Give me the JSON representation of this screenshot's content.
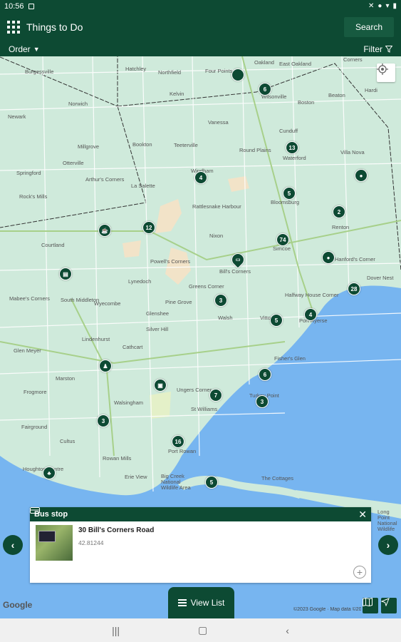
{
  "status": {
    "time": "10:56"
  },
  "header": {
    "title": "Things to Do",
    "search_label": "Search",
    "order_label": "Order",
    "filter_label": "Filter"
  },
  "map": {
    "places": [
      "Burgessville",
      "Hatchley",
      "Northfield",
      "Four Points",
      "Oakland",
      "East Oakland",
      "Corners",
      "Norwich",
      "Kelvin",
      "Wilsonville",
      "Boston",
      "Beaton",
      "Hardi",
      "Newark",
      "Vanessa",
      "Cunduff",
      "Millgrove",
      "Otterville",
      "Bookton",
      "Teeterville",
      "Round Plains",
      "Waterford",
      "Villa Nova",
      "Windham",
      "Springford",
      "Arthur's Corners",
      "La Salette",
      "Bloomsburg",
      "Rock's Mills",
      "Rattlesnake Harbour",
      "Renton",
      "Courtland",
      "Nixon",
      "Simcoe",
      "Bill's Corners",
      "Powell's Corners",
      "Lynedoch",
      "Greens Corner",
      "Mabee's Corners",
      "South Middleton",
      "Wyecombe",
      "Pine Grove",
      "Walsh",
      "Vittoria",
      "Port Ryerse",
      "Hanford's Corner",
      "Dover Nest",
      "Halfway House Corner",
      "Glenshee",
      "Silver Hill",
      "Lindenhurst",
      "Cathcart",
      "Fisher's Glen",
      "Glen Meyer",
      "Marston",
      "Frogmore",
      "Ungers Corner",
      "Turkey Point",
      "Walsingham",
      "St Williams",
      "Fairground",
      "Cultus",
      "Port Rowan",
      "Rowan Mills",
      "Erie View",
      "Big Creek National Wildlife Area",
      "Houghton Centre",
      "The Cottages",
      "Long Point National Wildlife"
    ],
    "markers": [
      "",
      "6",
      "13",
      "4",
      "5",
      "2",
      "12",
      "74",
      "",
      "",
      "",
      "3",
      "28",
      "5",
      "4",
      "",
      "6",
      "7",
      "3",
      "",
      "3",
      "16",
      "5",
      ""
    ],
    "marker_icons": [
      "pin-icon",
      "ticket-icon",
      "cup-icon",
      "pin-icon",
      "hiker-icon",
      "shopping-bag-icon",
      "bus-stop-icon",
      "tree-icon"
    ],
    "google": "Google",
    "copyright": "©2023 Google · Map data ©2023"
  },
  "popup": {
    "category": "Bus stop",
    "title": "30 Bill's Corners Road",
    "subtitle": "42.81244"
  },
  "view_list_label": "View List",
  "colors": {
    "brand": "#0d4a33",
    "land": "#cfeadb",
    "water": "#77b5f0"
  }
}
